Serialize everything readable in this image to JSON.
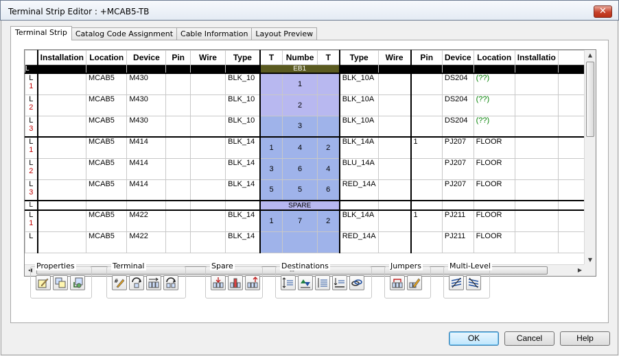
{
  "window": {
    "title": "Terminal Strip Editor : +MCAB5-TB",
    "close_label": "✕"
  },
  "tabs": [
    {
      "label": "Terminal Strip",
      "active": true
    },
    {
      "label": "Catalog Code Assignment",
      "active": false
    },
    {
      "label": "Cable Information",
      "active": false
    },
    {
      "label": "Layout Preview",
      "active": false
    }
  ],
  "grid": {
    "columns": [
      "Installation",
      "Location",
      "Device",
      "Pin",
      "Wire",
      "Type",
      "T",
      "Numbe",
      "T",
      "Type",
      "Wire",
      "Pin",
      "Device",
      "Location",
      "Installatio"
    ],
    "banner_eb1": "EB1",
    "banner_spare": "SPARE",
    "rows": [
      {
        "lvl": "L",
        "num": "1",
        "left_loc": "MCAB5",
        "left_dev": "M430",
        "left_type": "BLK_10",
        "t1": "",
        "number": "1",
        "t2": "",
        "right_type": "BLK_10A",
        "right_pin": "",
        "right_dev": "DS204",
        "right_loc": "(??)",
        "group_top": true
      },
      {
        "lvl": "L",
        "num": "2",
        "left_loc": "MCAB5",
        "left_dev": "M430",
        "left_type": "BLK_10",
        "t1": "",
        "number": "2",
        "t2": "",
        "right_type": "BLK_10A",
        "right_pin": "",
        "right_dev": "DS204",
        "right_loc": "(??)",
        "group_top": false
      },
      {
        "lvl": "L",
        "num": "3",
        "left_loc": "MCAB5",
        "left_dev": "M430",
        "left_type": "BLK_10",
        "t1": "",
        "number": "3",
        "t2": "",
        "right_type": "BLK_10A",
        "right_pin": "",
        "right_dev": "DS204",
        "right_loc": "(??)",
        "group_top": false
      },
      {
        "lvl": "L",
        "num": "1",
        "left_loc": "MCAB5",
        "left_dev": "M414",
        "left_type": "BLK_14",
        "t1": "1",
        "number": "4",
        "t2": "2",
        "right_type": "BLK_14A",
        "right_pin": "1",
        "right_dev": "PJ207",
        "right_loc": "FLOOR",
        "group_top": true
      },
      {
        "lvl": "L",
        "num": "2",
        "left_loc": "MCAB5",
        "left_dev": "M414",
        "left_type": "BLK_14",
        "t1": "3",
        "number": "6",
        "t2": "4",
        "right_type": "BLU_14A",
        "right_pin": "",
        "right_dev": "PJ207",
        "right_loc": "FLOOR",
        "group_top": false
      },
      {
        "lvl": "L",
        "num": "3",
        "left_loc": "MCAB5",
        "left_dev": "M414",
        "left_type": "BLK_14",
        "t1": "5",
        "number": "5",
        "t2": "6",
        "right_type": "RED_14A",
        "right_pin": "",
        "right_dev": "PJ207",
        "right_loc": "FLOOR",
        "group_top": false
      },
      {
        "lvl": "L",
        "num": "1",
        "left_loc": "MCAB5",
        "left_dev": "M422",
        "left_type": "BLK_14",
        "t1": "1",
        "number": "7",
        "t2": "2",
        "right_type": "BLK_14A",
        "right_pin": "1",
        "right_dev": "PJ211",
        "right_loc": "FLOOR",
        "group_top": true
      },
      {
        "lvl": "L",
        "num": "",
        "left_loc": "MCAB5",
        "left_dev": "M422",
        "left_type": "BLK_14",
        "t1": "",
        "number": "",
        "t2": "",
        "right_type": "RED_14A",
        "right_pin": "",
        "right_dev": "PJ211",
        "right_loc": "FLOOR",
        "group_top": false
      }
    ],
    "hscroll_grip": "III"
  },
  "groups": {
    "properties": {
      "label": "Properties"
    },
    "terminal": {
      "label": "Terminal"
    },
    "spare": {
      "label": "Spare"
    },
    "destinations": {
      "label": "Destinations"
    },
    "jumpers": {
      "label": "Jumpers"
    },
    "multilevel": {
      "label": "Multi-Level"
    }
  },
  "buttons": {
    "ok": "OK",
    "cancel": "Cancel",
    "help": "Help"
  }
}
